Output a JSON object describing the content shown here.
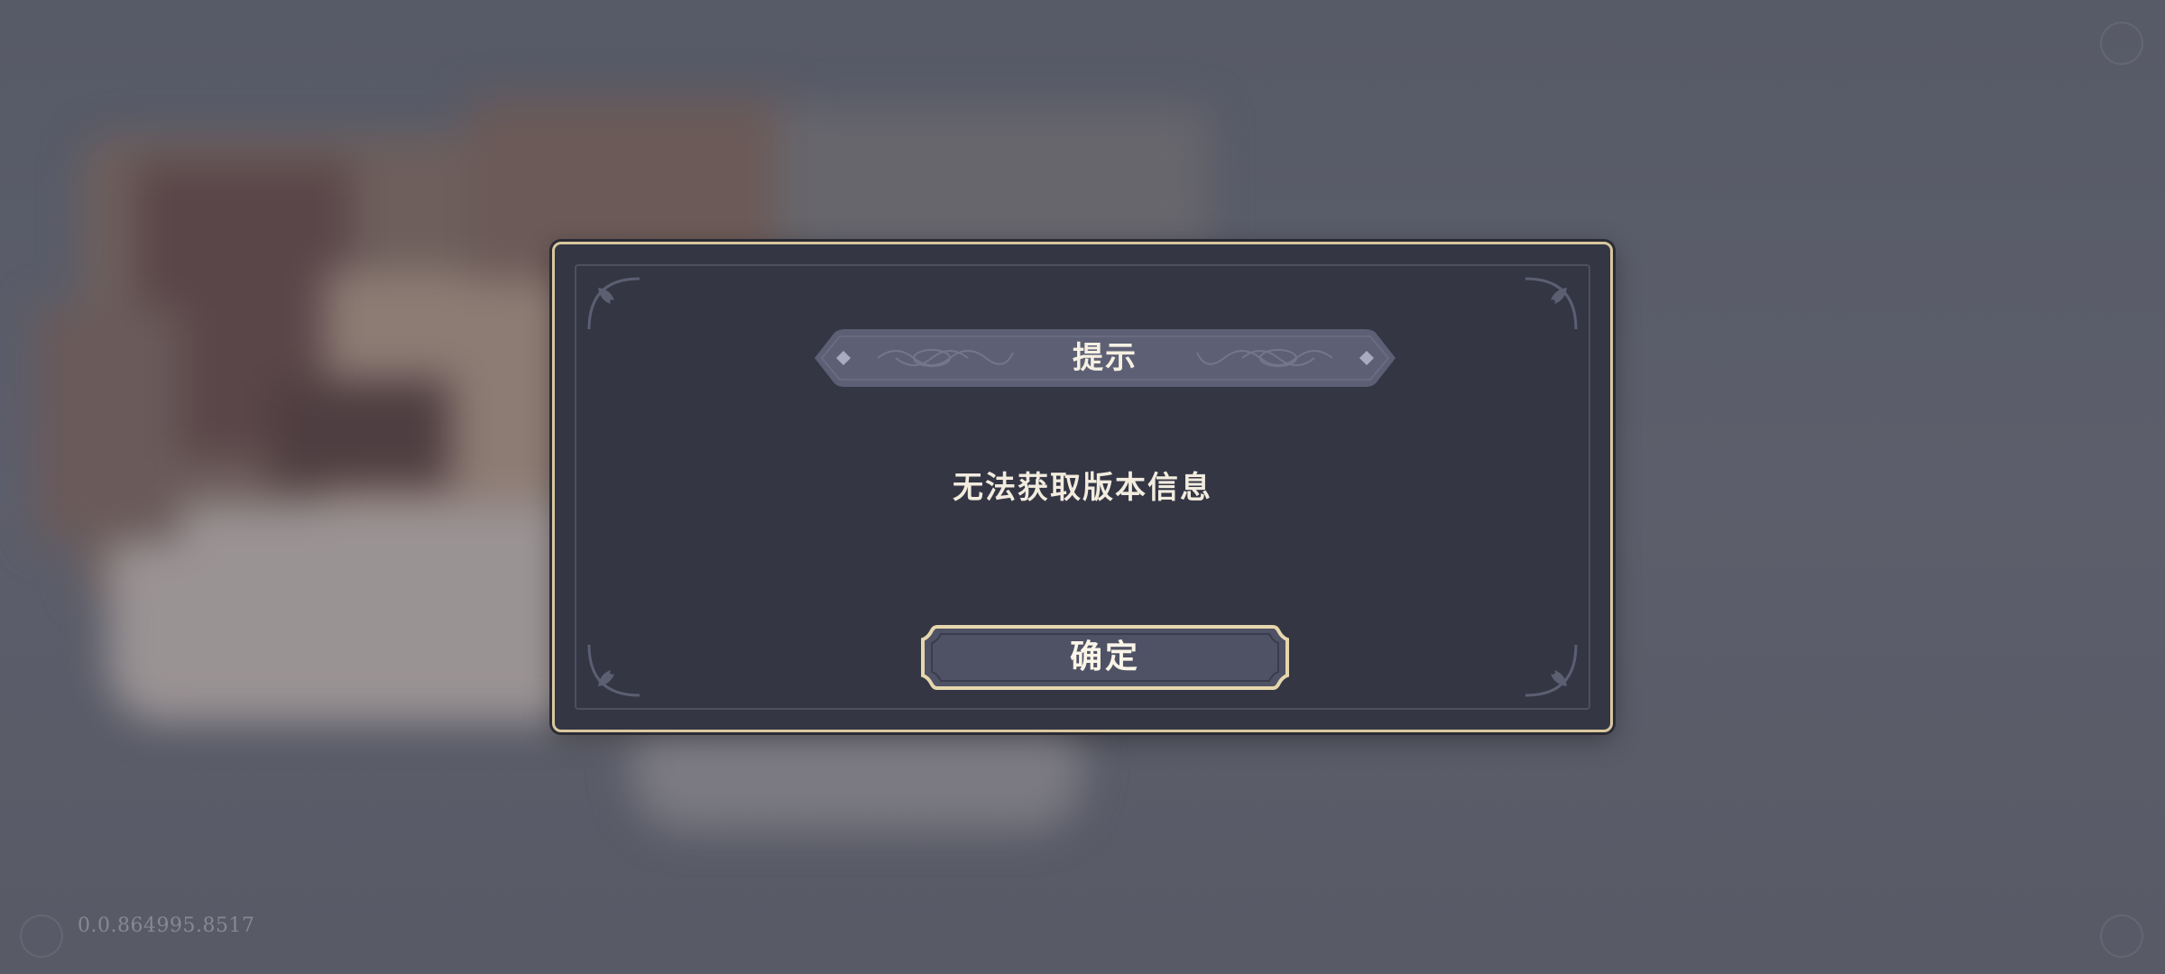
{
  "dialog": {
    "title": "提示",
    "message": "无法获取版本信息",
    "confirm_label": "确定"
  },
  "footer": {
    "version": "0.0.864995.8517"
  },
  "colors": {
    "dialog_bg": "#343644",
    "dialog_border": "#d8c79e",
    "title_banner": "#5d6075",
    "button_bg": "#4f5265",
    "text": "#f2ecdf"
  },
  "icons": [
    "corner-ornament-icon",
    "diamond-icon",
    "scroll-flourish-icon"
  ]
}
